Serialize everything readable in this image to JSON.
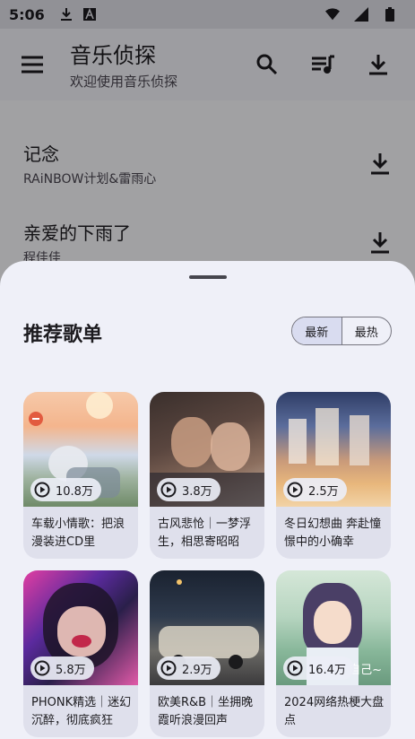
{
  "status_bar": {
    "time": "5:06"
  },
  "app": {
    "title": "音乐侦探",
    "subtitle": "欢迎使用音乐侦探"
  },
  "songs": [
    {
      "title": "记念",
      "artist": "RAiNBOW计划&雷雨心"
    },
    {
      "title": "亲爱的下雨了",
      "artist": "程佳佳"
    }
  ],
  "sheet": {
    "title": "推荐歌单",
    "segments": [
      "最新",
      "最热"
    ],
    "selected_segment": "最新",
    "playlists": [
      {
        "plays": "10.8万",
        "desc": "车载小情歌：把浪漫装进CD里"
      },
      {
        "plays": "3.8万",
        "desc": "古风悲怆｜一梦浮生，相思寄昭昭"
      },
      {
        "plays": "2.5万",
        "desc": "冬日幻想曲 奔赴憧憬中的小确幸"
      },
      {
        "plays": "5.8万",
        "desc": "PHONK精选｜迷幻沉醉，彻底疯狂"
      },
      {
        "plays": "2.9万",
        "desc": "欧美R&B｜坐拥晚霞听浪漫回声"
      },
      {
        "plays": "16.4万",
        "desc": "2024网络热梗大盘点",
        "cover_text": "自己~"
      }
    ]
  },
  "colors": {
    "accent_segment": "#d9dcf0",
    "sheet_bg": "#eff0f8",
    "card_bg": "#dfe0ec"
  }
}
